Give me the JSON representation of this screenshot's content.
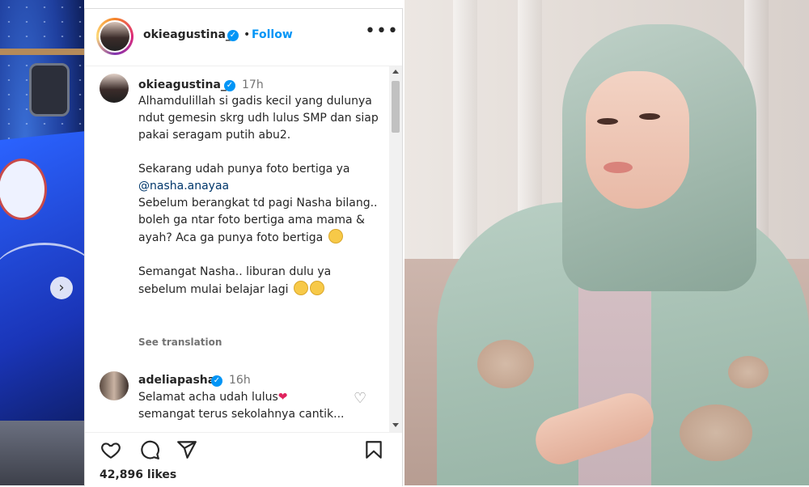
{
  "post": {
    "header": {
      "username": "okieagustina_",
      "separator": "•",
      "follow_label": "Follow",
      "more_label": "•••"
    },
    "caption": {
      "username": "okieagustina_",
      "time": "17h",
      "line1": "Alhamdulillah si gadis kecil yang dulunya ndut gemesin skrg udh lulus SMP dan siap pakai seragam putih abu2.",
      "line2_before": "Sekarang udah punya foto bertiga ya ",
      "mention": "@nasha.anayaa",
      "line3": "Sebelum berangkat td pagi Nasha bilang.. boleh ga ntar foto bertiga ama mama & ayah? Aca ga punya foto bertiga",
      "line4": "Semangat Nasha.. liburan dulu ya sebelum mulai belajar lagi",
      "see_translation": "See translation"
    },
    "comment": {
      "username": "adeliapasha",
      "time": "16h",
      "text_part1": "Selamat acha udah lulus",
      "heart": "❤",
      "text_part2": "semangat terus sekolahnya cantik..."
    },
    "actions": {
      "like_icon": "heart-icon",
      "comment_icon": "comment-icon",
      "share_icon": "share-icon",
      "save_icon": "bookmark-icon"
    },
    "likes": "42,896 likes"
  },
  "carousel": {
    "next_icon": "chevron-right-icon",
    "next_glyph": "›"
  },
  "colors": {
    "link_blue": "#0095f6",
    "mention": "#00376b",
    "muted": "#737373"
  }
}
